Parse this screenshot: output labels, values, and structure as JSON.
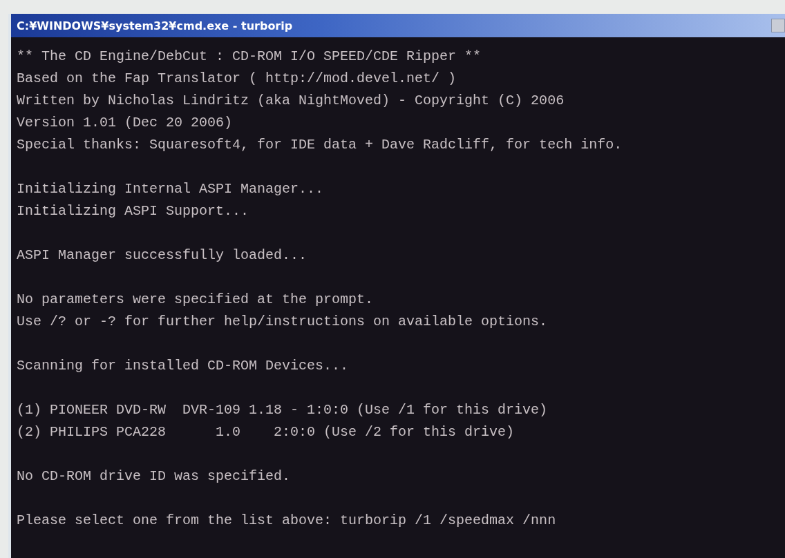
{
  "window": {
    "title": "C:¥WINDOWS¥system32¥cmd.exe - turborip"
  },
  "console": {
    "blocks": [
      [
        "** The CD Engine/DebCut : CD-ROM I/O SPEED/CDE Ripper **",
        "Based on the Fap Translator ( http://mod.devel.net/ )",
        "Written by Nicholas Lindritz (aka NightMoved) - Copyright (C) 2006",
        "Version 1.01 (Dec 20 2006)",
        "Special thanks: Squaresoft4, for IDE data + Dave Radcliff, for tech info."
      ],
      [
        "Initializing Internal ASPI Manager...",
        "Initializing ASPI Support..."
      ],
      [
        "ASPI Manager successfully loaded..."
      ],
      [
        "No parameters were specified at the prompt.",
        "Use /? or -? for further help/instructions on available options."
      ],
      [
        "Scanning for installed CD-ROM Devices..."
      ],
      [
        "(1) PIONEER DVD-RW  DVR-109 1.18 - 1:0:0 (Use /1 for this drive)",
        "(2) PHILIPS PCA228      1.0    2:0:0 (Use /2 for this drive)"
      ],
      [
        "No CD-ROM drive ID was specified."
      ],
      [
        "Please select one from the list above: turborip /1 /speedmax /nnn"
      ]
    ]
  }
}
